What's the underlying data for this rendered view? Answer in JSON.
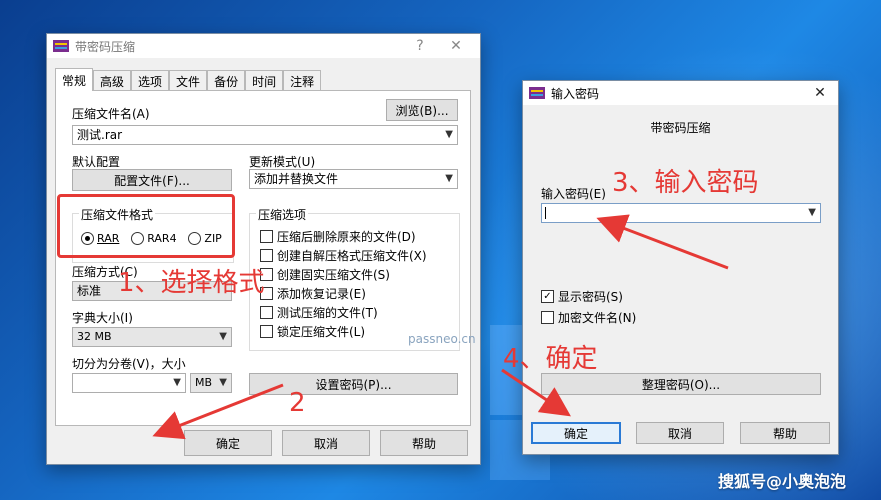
{
  "compress_dialog": {
    "title": "带密码压缩",
    "help_symbol": "?",
    "close_symbol": "✕",
    "tabs": [
      "常规",
      "高级",
      "选项",
      "文件",
      "备份",
      "时间",
      "注释"
    ],
    "archive_name_label": "压缩文件名(A)",
    "browse_button": "浏览(B)...",
    "archive_name_value": "测试.rar",
    "default_profile_label": "默认配置",
    "profiles_button": "配置文件(F)...",
    "update_mode_label": "更新模式(U)",
    "update_mode_value": "添加并替换文件",
    "format_group_title": "压缩文件格式",
    "formats": [
      "RAR",
      "RAR4",
      "ZIP"
    ],
    "selected_format": "RAR",
    "method_label": "压缩方式(C)",
    "method_value": "标准",
    "dict_label": "字典大小(I)",
    "dict_value": "32 MB",
    "split_label": "切分为分卷(V)，大小",
    "split_value": "",
    "split_unit": "MB",
    "options_group_title": "压缩选项",
    "options": [
      {
        "label": "压缩后删除原来的文件(D)",
        "checked": false
      },
      {
        "label": "创建自解压格式压缩文件(X)",
        "checked": false
      },
      {
        "label": "创建固实压缩文件(S)",
        "checked": false
      },
      {
        "label": "添加恢复记录(E)",
        "checked": false
      },
      {
        "label": "测试压缩的文件(T)",
        "checked": false
      },
      {
        "label": "锁定压缩文件(L)",
        "checked": false
      }
    ],
    "set_password_button": "设置密码(P)...",
    "ok_button": "确定",
    "cancel_button": "取消",
    "help_button": "帮助"
  },
  "password_dialog": {
    "title": "输入密码",
    "close_symbol": "✕",
    "subtitle": "带密码压缩",
    "password_label": "输入密码(E)",
    "password_value": "",
    "show_password_label": "显示密码(S)",
    "show_password_checked": true,
    "encrypt_names_label": "加密文件名(N)",
    "encrypt_names_checked": false,
    "organize_button": "整理密码(O)...",
    "ok_button": "确定",
    "cancel_button": "取消",
    "help_button": "帮助"
  },
  "annotations": {
    "step1": "1、选择格式",
    "step2": "2",
    "step3": "3、输入密码",
    "step4": "4、确定",
    "color": "#e53935"
  },
  "watermarks": {
    "site": "passneo.cn",
    "brand": "搜狐号@小奥泡泡"
  }
}
